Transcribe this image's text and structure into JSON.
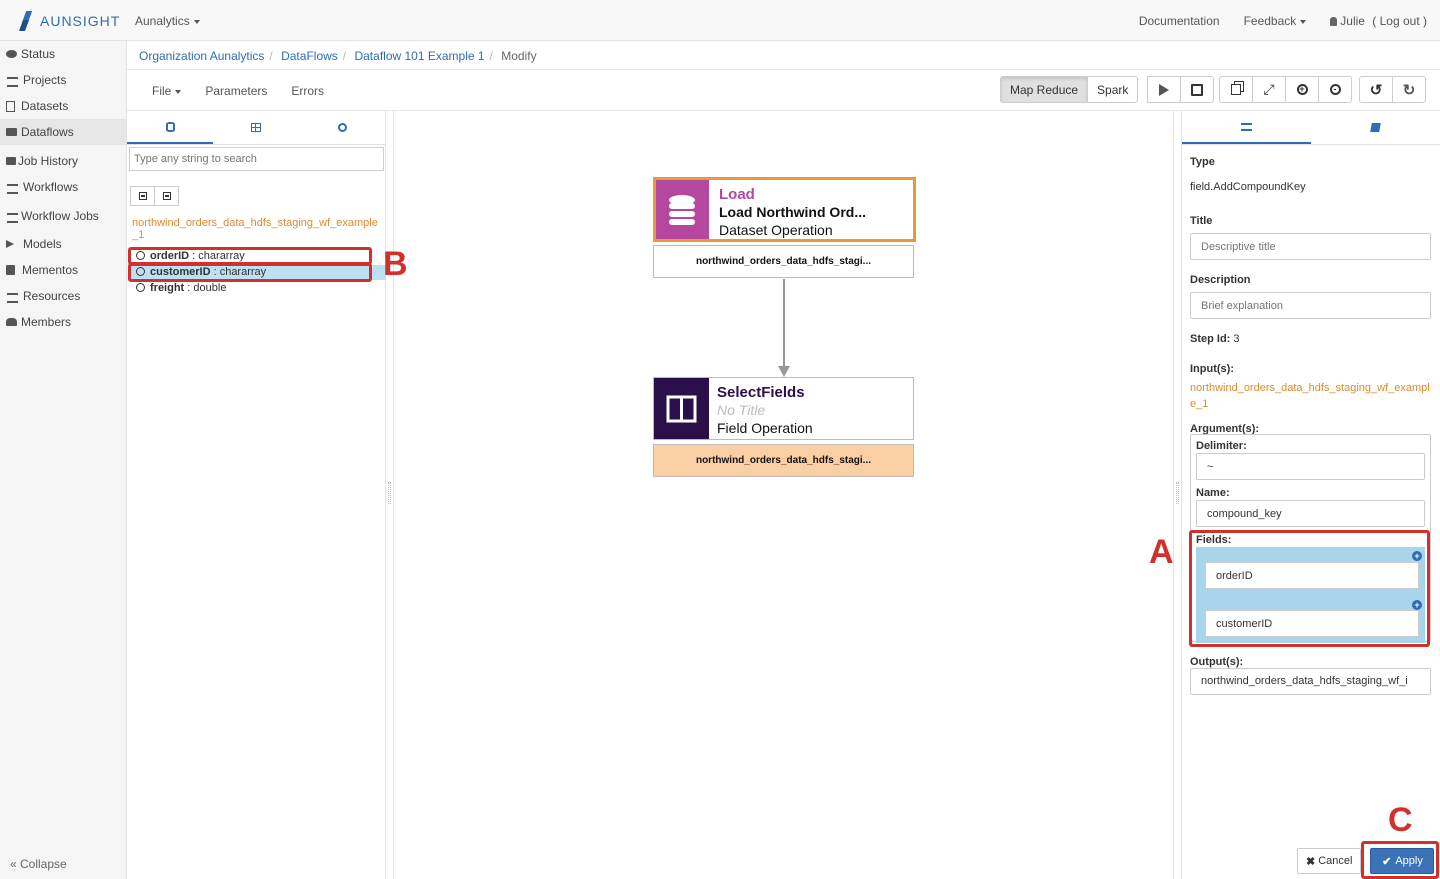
{
  "nav": {
    "brand": "AUNSIGHT",
    "org_dropdown": "Aunalytics",
    "documentation": "Documentation",
    "feedback": "Feedback",
    "user": "Julie",
    "logout": "( Log out )"
  },
  "sidebar": {
    "items": [
      {
        "label": "Status"
      },
      {
        "label": "Projects"
      },
      {
        "label": "Datasets"
      },
      {
        "label": "Dataflows"
      },
      {
        "label": "Job History"
      },
      {
        "label": "Workflows"
      },
      {
        "label": "Workflow Jobs"
      },
      {
        "label": "Models"
      },
      {
        "label": "Mementos"
      },
      {
        "label": "Resources"
      },
      {
        "label": "Members"
      }
    ],
    "collapse": "« Collapse"
  },
  "breadcrumb": {
    "items": [
      "Organization Aunalytics",
      "DataFlows",
      "Dataflow 101 Example 1"
    ],
    "current": "Modify"
  },
  "toolbar": {
    "file": "File",
    "parameters": "Parameters",
    "errors": "Errors",
    "map_reduce": "Map Reduce",
    "spark": "Spark"
  },
  "left_panel": {
    "search_placeholder": "Type any string to search",
    "dataset_name": "northwind_orders_data_hdfs_staging_wf_example_1",
    "fields": [
      {
        "name": "orderID",
        "type": " : chararray"
      },
      {
        "name": "customerID",
        "type": " : chararray"
      },
      {
        "name": "freight",
        "type": " : double"
      }
    ]
  },
  "canvas": {
    "nodes": [
      {
        "title": "Load",
        "subtitle": "Load Northwind Ord...",
        "type": "Dataset Operation",
        "output": "northwind_orders_data_hdfs_stagi...",
        "color": "#b5489e"
      },
      {
        "title": "SelectFields",
        "subtitle": "No Title",
        "type": "Field Operation",
        "output": "northwind_orders_data_hdfs_stagi...",
        "color": "#2b0f4a"
      }
    ]
  },
  "right_panel": {
    "type_label": "Type",
    "type_value": "field.AddCompoundKey",
    "title_label": "Title",
    "title_placeholder": "Descriptive title",
    "description_label": "Description",
    "description_placeholder": "Brief explanation",
    "step_id_label": "Step Id:",
    "step_id_value": "3",
    "inputs_label": "Input(s):",
    "inputs_value": "northwind_orders_data_hdfs_staging_wf_example_1",
    "arguments_label": "Argument(s):",
    "delimiter_label": "Delimiter:",
    "delimiter_value": "~",
    "name_label": "Name:",
    "name_value": "compound_key",
    "fields_label": "Fields:",
    "fields": [
      "orderID",
      "customerID"
    ],
    "outputs_label": "Output(s):",
    "outputs_value": "northwind_orders_data_hdfs_staging_wf_i"
  },
  "buttons": {
    "cancel": "Cancel",
    "apply": "Apply"
  },
  "annotations": {
    "a": "A",
    "b": "B",
    "c": "C"
  }
}
